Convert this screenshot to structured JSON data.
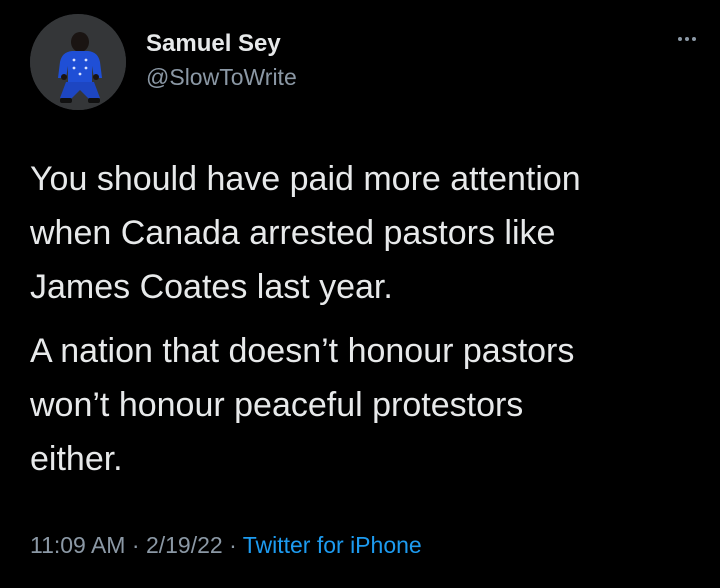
{
  "author": {
    "name": "Samuel Sey",
    "handle": "@SlowToWrite",
    "avatar_icon": "person-avatar-icon"
  },
  "more_icon": "more-options-icon",
  "tweet": {
    "paragraph_1_lines": [
      "You should have paid more attention",
      "when Canada arrested pastors like",
      "James Coates last year."
    ],
    "paragraph_2_lines": [
      "A nation that doesn’t honour pastors",
      "won’t honour peaceful protestors",
      "either."
    ]
  },
  "meta": {
    "time": "11:09 AM",
    "separator": " · ",
    "date": "2/19/22",
    "source": "Twitter for iPhone"
  },
  "colors": {
    "background": "#000000",
    "text": "#e7e9ea",
    "secondary": "#8b98a5",
    "accent": "#1d9bf0"
  }
}
